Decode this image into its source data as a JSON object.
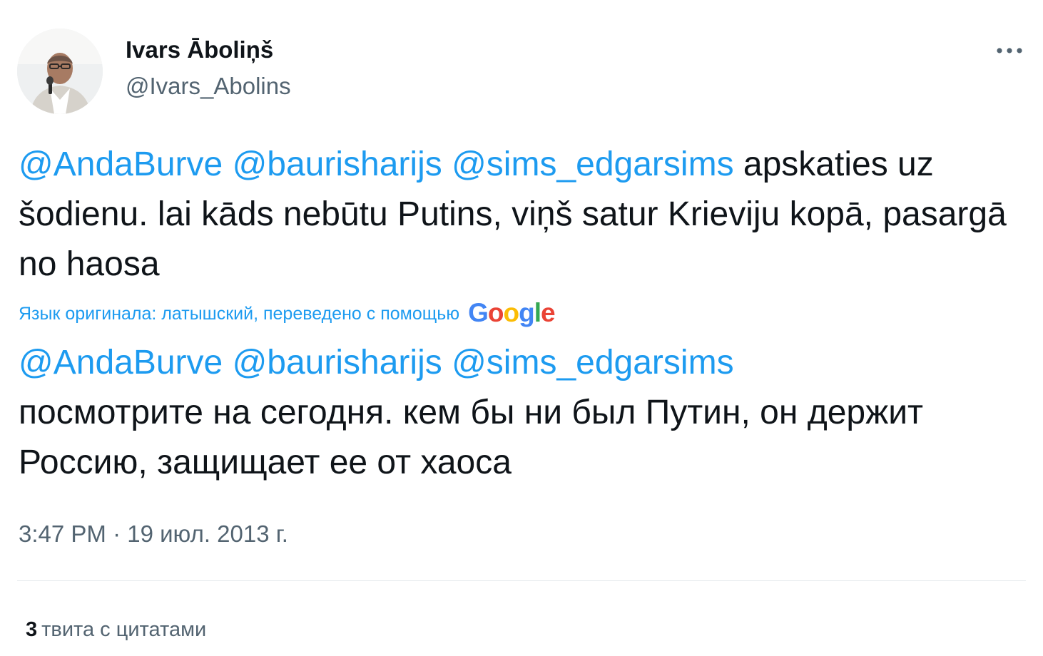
{
  "author": {
    "display_name": "Ivars Āboliņš",
    "handle": "@Ivars_Abolins"
  },
  "more_icon": "more-horizontal-icon",
  "original": {
    "mentions": [
      "@AndaBurve",
      "@baurisharijs",
      "@sims_edgarsims"
    ],
    "text": "apskaties uz šodienu. lai kāds nebūtu Putins, viņš satur Krieviju kopā, pasargā no haosa"
  },
  "translation": {
    "note": "Язык оригинала: латышский, переведено с помощью",
    "provider": "Google",
    "mentions": [
      "@AndaBurve",
      "@baurisharijs",
      "@sims_edgarsims"
    ],
    "text": "посмотрите на сегодня. кем бы ни был Путин, он держит Россию, защищает ее от хаоса"
  },
  "meta": {
    "time": "3:47 PM",
    "separator": "·",
    "date": "19 июл. 2013 г."
  },
  "quotes": {
    "count": "3",
    "label": "твита с цитатами"
  },
  "colors": {
    "link": "#1d9bf0",
    "text": "#0f1419",
    "secondary": "#536471",
    "divider": "#e4e8eb",
    "google_blue": "#4285f4",
    "google_red": "#ea4335",
    "google_yellow": "#fbbc05",
    "google_green": "#34a853"
  }
}
